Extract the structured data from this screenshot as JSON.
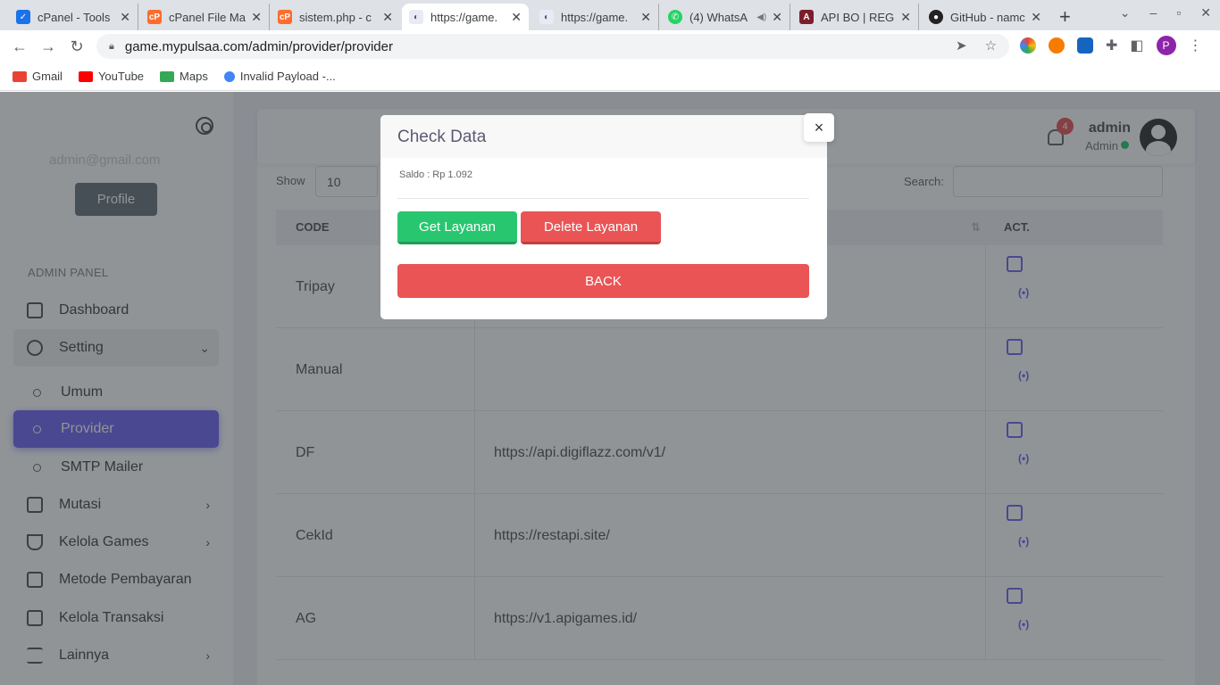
{
  "browser": {
    "tabs": [
      {
        "title": "cPanel - Tools",
        "favicon": "cpanel-icon",
        "active": false
      },
      {
        "title": "cPanel File Ma",
        "favicon": "cpanel-orange-icon",
        "active": false
      },
      {
        "title": "sistem.php - c",
        "favicon": "cpanel-orange-icon",
        "active": false
      },
      {
        "title": "https://game.",
        "favicon": "site-icon",
        "active": true
      },
      {
        "title": "https://game.",
        "favicon": "site-icon",
        "active": false
      },
      {
        "title": "(4) WhatsA",
        "favicon": "whatsapp-icon",
        "active": false
      },
      {
        "title": "API BO | REGI",
        "favicon": "api-icon",
        "active": false
      },
      {
        "title": "GitHub - namc",
        "favicon": "github-icon",
        "active": false
      }
    ],
    "new_tab": "+",
    "url": "game.mypulsaa.com/admin/provider/provider",
    "profile_initial": "P",
    "bookmarks": [
      {
        "label": "Gmail",
        "color": "#ea4335"
      },
      {
        "label": "YouTube",
        "color": "#ff0000"
      },
      {
        "label": "Maps",
        "color": "#34a853"
      },
      {
        "label": "Invalid Payload -...",
        "color": "#4285f4"
      }
    ]
  },
  "sidebar": {
    "email": "admin@gmail.com",
    "profile_button": "Profile",
    "section": "ADMIN PANEL",
    "items": [
      {
        "label": "Dashboard",
        "icon": "home-icon"
      },
      {
        "label": "Setting",
        "icon": "gear-icon",
        "arrow": "⌄"
      },
      {
        "label": "Umum",
        "sub": true
      },
      {
        "label": "Provider",
        "sub": true,
        "active": true
      },
      {
        "label": "SMTP Mailer",
        "sub": true
      },
      {
        "label": "Mutasi",
        "icon": "card-icon",
        "arrow": "›"
      },
      {
        "label": "Kelola Games",
        "icon": "gamepad-icon",
        "arrow": "›"
      },
      {
        "label": "Metode Pembayaran",
        "icon": "card-icon"
      },
      {
        "label": "Kelola Transaksi",
        "icon": "bag-icon"
      },
      {
        "label": "Lainnya",
        "icon": "list-icon",
        "arrow": "›"
      }
    ]
  },
  "header": {
    "notifications": "4",
    "user_name": "admin",
    "user_role": "Admin"
  },
  "table": {
    "show_label": "Show",
    "show_value": "10",
    "search_label": "Search:",
    "columns": [
      "CODE",
      "ACT."
    ],
    "rows": [
      {
        "code": "Tripay",
        "url": ""
      },
      {
        "code": "Manual",
        "url": ""
      },
      {
        "code": "DF",
        "url": "https://api.digiflazz.com/v1/"
      },
      {
        "code": "CekId",
        "url": "https://restapi.site/"
      },
      {
        "code": "AG",
        "url": "https://v1.apigames.id/"
      }
    ]
  },
  "modal": {
    "title": "Check Data",
    "close": "×",
    "saldo": "Saldo : Rp 1.092",
    "get_button": "Get Layanan",
    "delete_button": "Delete Layanan",
    "back_button": "BACK"
  },
  "colors": {
    "primary": "#7367f0",
    "success": "#28c76f",
    "danger": "#ea5455"
  }
}
